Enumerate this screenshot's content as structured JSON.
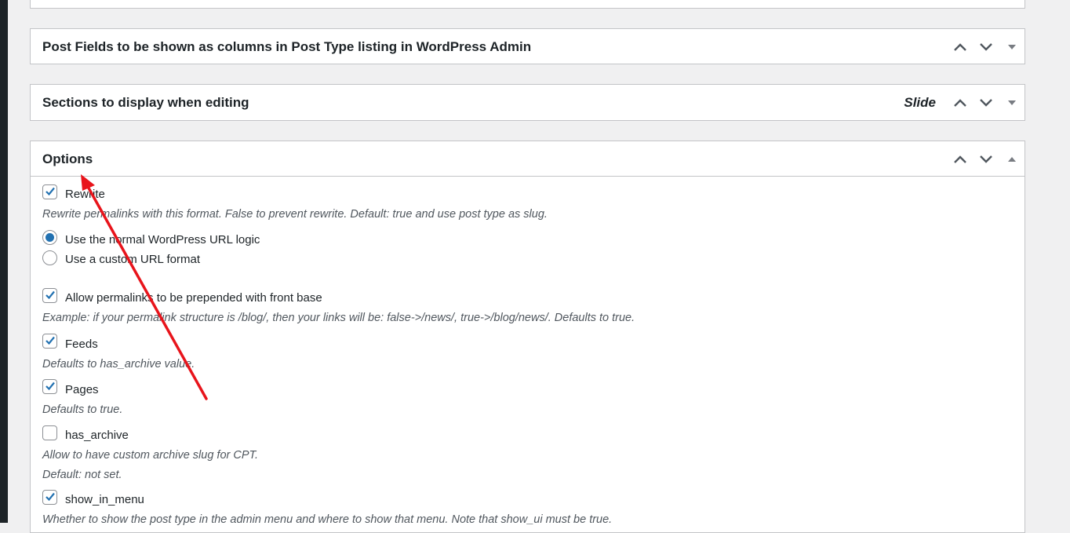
{
  "boxes": [
    {
      "title": "Post Fields to be shown as columns in Post Type listing in WordPress Admin",
      "badge": ""
    },
    {
      "title": "Sections to display when editing",
      "badge": "Slide"
    },
    {
      "title": "Options",
      "badge": ""
    }
  ],
  "options": {
    "rewrite": {
      "label": "Rewrite",
      "checked": true,
      "desc": "Rewrite permalinks with this format. False to prevent rewrite. Default: true and use post type as slug."
    },
    "url_logic": {
      "normal_label": "Use the normal WordPress URL logic",
      "custom_label": "Use a custom URL format",
      "selected": "normal"
    },
    "with_front": {
      "label": "Allow permalinks to be prepended with front base",
      "checked": true,
      "desc": "Example: if your permalink structure is /blog/, then your links will be: false->/news/, true->/blog/news/. Defaults to true."
    },
    "feeds": {
      "label": "Feeds",
      "checked": true,
      "desc": "Defaults to has_archive value."
    },
    "pages": {
      "label": "Pages",
      "checked": true,
      "desc": "Defaults to true."
    },
    "has_archive": {
      "label": "has_archive",
      "checked": false,
      "desc1": "Allow to have custom archive slug for CPT.",
      "desc2": "Default: not set."
    },
    "show_in_menu": {
      "label": "show_in_menu",
      "checked": true,
      "desc": "Whether to show the post type in the admin menu and where to show that menu. Note that show_ui must be true."
    }
  },
  "colors": {
    "accent": "#2271b1",
    "annotation": "#e8141b"
  }
}
